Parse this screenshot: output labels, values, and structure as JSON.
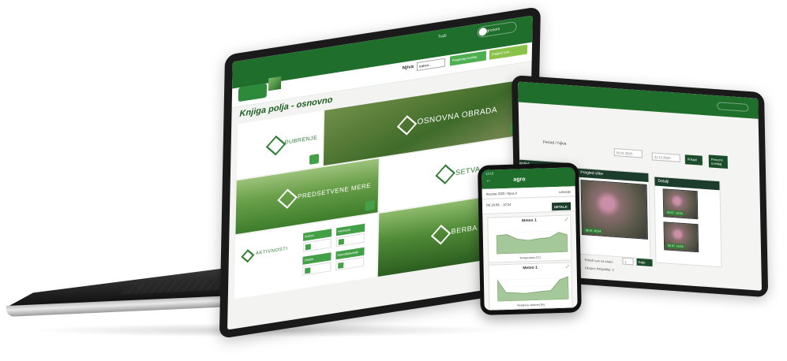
{
  "laptop": {
    "nav": {
      "user_label": "agronom",
      "search_label": "Traži"
    },
    "toolbar": {
      "field_label": "Njiva",
      "field_select": "Izaberi...",
      "btn_primary": "Pregledaj izveštaj",
      "btn_secondary": "Pregled svih..."
    },
    "page_title": "Knjiga polja - osnovno",
    "tiles": [
      {
        "label": "ĐUBRENJE"
      },
      {
        "label": "OSNOVNA OBRADA"
      },
      {
        "label": "PREDSETVENE MERE"
      },
      {
        "label": "SETVA"
      },
      {
        "label": "AKTIVNOSTI"
      },
      {
        "label": "BERBA"
      }
    ],
    "mini_buttons": [
      "Ručno",
      "Herbicidi",
      "Ostalo",
      "Navodnjavanje"
    ]
  },
  "tablet": {
    "filter_label": "Period / Njiva",
    "date_from": "01.01.2020.",
    "date_to": "31.12.2020.",
    "btn_search": "Prikaži",
    "btn_export": "Preuzmi izveštaj",
    "panels": [
      {
        "title": "Pregled"
      },
      {
        "title": "Pregled slike"
      },
      {
        "title": "Detalji"
      }
    ],
    "footer_label": "Prikaži sve na strani",
    "footer_page": "1",
    "footer_btn": "Dalje",
    "footer_note": "Ukupno fotografija: 3",
    "image_caption": "05.07. 10:24"
  },
  "phone": {
    "status_time": "13:10",
    "brand": "agro",
    "row1": "Sezona 2020 / Njiva 3",
    "row1_right": "Lokacija",
    "row2": "Od 20.06. - 10:24",
    "detalji": "DETALJI",
    "cards": [
      {
        "title": "Meteo 1",
        "legend": "Temperatura [°C]"
      },
      {
        "title": "Meteo 1",
        "legend": "Relativna vlažnost [%]"
      }
    ]
  }
}
